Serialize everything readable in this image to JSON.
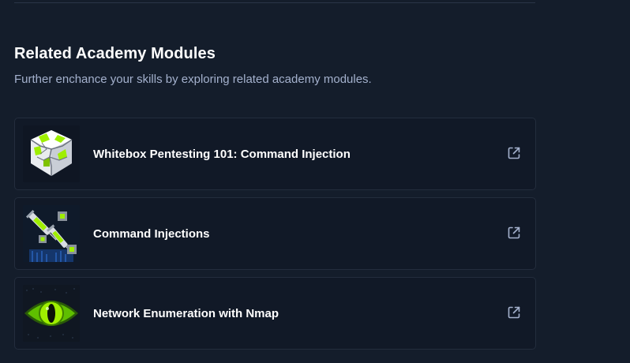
{
  "section": {
    "title": "Related Academy Modules",
    "subtitle": "Further enchance your skills by exploring related academy modules."
  },
  "modules": [
    {
      "title": "Whitebox Pentesting 101: Command Injection",
      "icon": "cracked-cube-thumbnail"
    },
    {
      "title": "Command Injections",
      "icon": "syringes-cubes-thumbnail"
    },
    {
      "title": "Network Enumeration with Nmap",
      "icon": "green-eye-thumbnail"
    }
  ],
  "icons": {
    "external_link": "external-link-icon"
  },
  "colors": {
    "background": "#141d2b",
    "card": "#111927",
    "accent_green": "#9fef00",
    "subtitle": "#a4b1cd"
  }
}
